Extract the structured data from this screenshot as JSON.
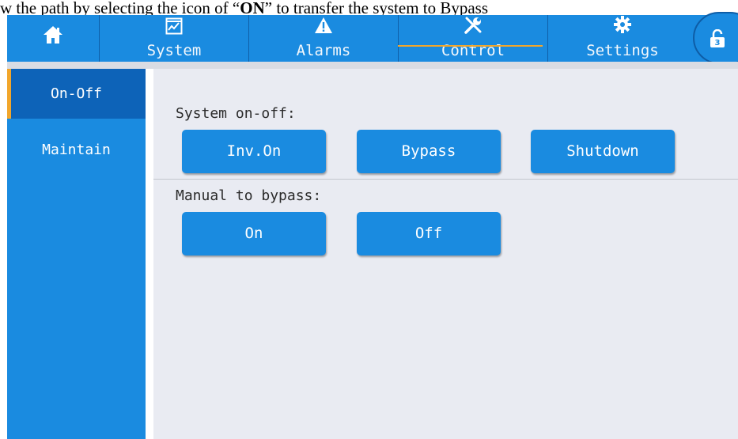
{
  "caption": {
    "prefix": "w the path by selecting the icon of “",
    "bold": "ON",
    "suffix": "” to transfer the system to Bypass"
  },
  "topnav": {
    "tabs": [
      {
        "label": "",
        "icon": "home-icon"
      },
      {
        "label": "System",
        "icon": "chart-icon"
      },
      {
        "label": "Alarms",
        "icon": "warning-icon"
      },
      {
        "label": "Control",
        "icon": "tools-icon",
        "active": true
      },
      {
        "label": "Settings",
        "icon": "gear-icon"
      }
    ],
    "lock": {
      "icon": "unlock-icon",
      "badge": "3"
    }
  },
  "sidebar": {
    "items": [
      {
        "label": "On-Off",
        "active": true
      },
      {
        "label": "Maintain",
        "active": false
      }
    ]
  },
  "main": {
    "system_onoff": {
      "label": "System on-off:",
      "buttons": [
        "Inv.On",
        "Bypass",
        "Shutdown"
      ]
    },
    "manual_bypass": {
      "label": "Manual to bypass:",
      "buttons": [
        "On",
        "Off"
      ]
    }
  },
  "colors": {
    "primary": "#1a8be0",
    "active_side": "#0d63b8",
    "accent": "#f2a62b",
    "panel_bg": "#e9ebf2"
  }
}
